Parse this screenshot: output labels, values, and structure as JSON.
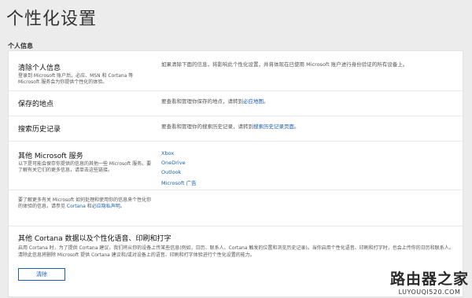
{
  "page_title": "个性化设置",
  "section_label": "个人信息",
  "rows": [
    {
      "heading": "清除个人信息",
      "desc": "登录到 Microsoft 账户后，必应、MSN 和 Cortana 等 Microsoft 服务会为你提供个性化的体验。",
      "right": "如果清除下面的信息，将影响此个性化设置，并将体现在已使用 Microsoft 账户进行身份验证的所有设备上。"
    },
    {
      "heading": "保存的地点",
      "right_prefix": "要查看和管理你保存的地点，请转到",
      "right_link": "必应地图",
      "right_suffix": "。"
    },
    {
      "heading": "搜索历史记录",
      "right_prefix": "要查看和管理你的搜索历史记录，请转到",
      "right_link": "搜索历史记录页面",
      "right_suffix": "。"
    },
    {
      "heading": "其他 Microsoft 服务",
      "desc": "以下是可能会保存你提供的信息的其他一些 Microsoft 服务。要了解有关它们的更多信息，请单击这些链接。",
      "links": [
        "Xbox",
        "OneDrive",
        "Outlook",
        "Microsoft 广告"
      ]
    },
    {
      "desc_prefix": "要了解更多有关 Microsoft 如何处理和使用你的信息来个性化你的体验的信息，请参见 ",
      "desc_link1": "Cortana",
      "desc_mid": " 和",
      "desc_link2": "必应隐私声明",
      "desc_suffix": "。"
    },
    {
      "heading": "其他 Cortana 数据以及个性化语音、印刷和打字",
      "desc": "启用 Cortana 时，为了提供 Cortana 建议，我们将从你的设备上传某些信息(例如，日历、联系人、Cortana 触发的位置和浏览历史记录)。当你启用个性化语音、印刷和打字时，也会上传你的日历和联系人。清除此信息将删除 Microsoft 提供 Cortana 建议和/或对设备上的语音、印刷和打字体验进行个性化设置的能力。",
      "button": "清除"
    }
  ],
  "watermark": {
    "main": "路由器之家",
    "sub": "LUYOUQI520.COM"
  }
}
